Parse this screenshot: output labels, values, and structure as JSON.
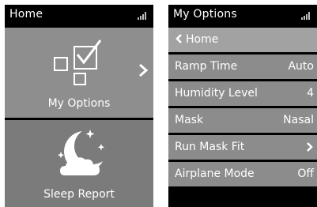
{
  "home": {
    "title": "Home",
    "tiles": [
      {
        "label": "My Options",
        "icon": "checklist-icon"
      },
      {
        "label": "Sleep Report",
        "icon": "moon-cloud-icon"
      }
    ]
  },
  "options": {
    "title": "My Options",
    "back_label": "Home",
    "rows": [
      {
        "label": "Ramp Time",
        "value": "Auto"
      },
      {
        "label": "Humidity Level",
        "value": "4"
      },
      {
        "label": "Mask",
        "value": "Nasal"
      },
      {
        "label": "Run Mask Fit",
        "value": ""
      },
      {
        "label": "Airplane Mode",
        "value": "Off"
      }
    ]
  },
  "colors": {
    "screen_bg": "#000000",
    "tile_bg": "#8e8e8e",
    "highlight_row": "#a2a2a2",
    "row_bg": "#8c8c8c",
    "text": "#ffffff"
  }
}
